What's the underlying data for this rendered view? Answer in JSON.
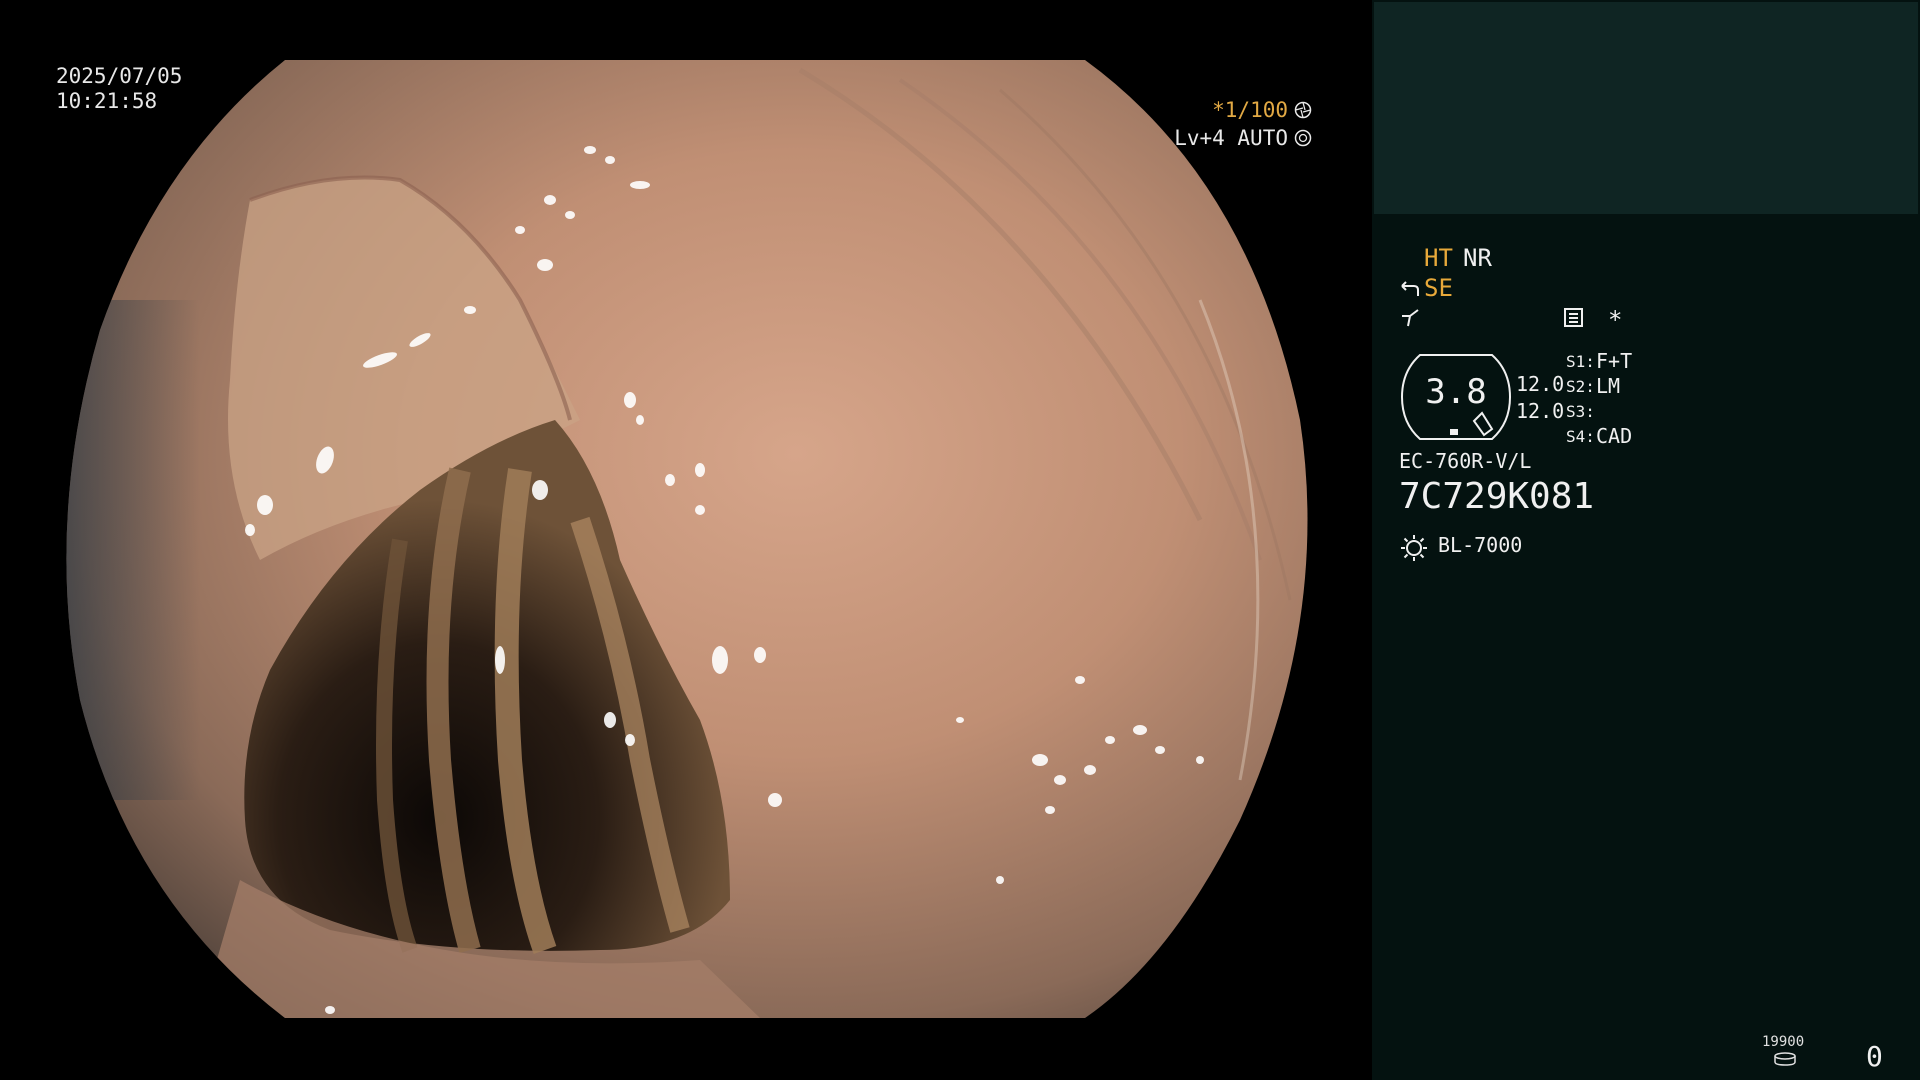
{
  "overlay": {
    "date": "2025/07/05",
    "time": "10:21:58",
    "shutter_speed": "*1/100",
    "shutter_icon": "aperture-icon",
    "brightness": "Lv+4 AUTO",
    "brightness_icon": "target-icon"
  },
  "panel": {
    "ht_label": "HT",
    "nr_label": "NR",
    "se_icon": "hook-arrow-icon",
    "se_label": "SE",
    "freeze_icon": "lightning-icon",
    "menu_icon": "list-icon",
    "star_label": "*",
    "gauge_value": "3.8",
    "zoom_values": [
      "12.0",
      "12.0"
    ],
    "switches": [
      {
        "key": "S1:",
        "value": "F+T"
      },
      {
        "key": "S2:",
        "value": "LM"
      },
      {
        "key": "S3:",
        "value": ""
      },
      {
        "key": "S4:",
        "value": "CAD"
      }
    ],
    "scope_model": "EC-760R-V/L",
    "scope_serial": "7C729K081",
    "light_source_icon": "sun-icon",
    "light_source": "BL-7000",
    "storage_icon": "disk-icon",
    "storage_remaining": "19900",
    "capture_count": "0"
  },
  "colors": {
    "accent_orange": "#e8a93a",
    "panel_bg": "#041210",
    "thumb_bg": "#0f2523"
  }
}
